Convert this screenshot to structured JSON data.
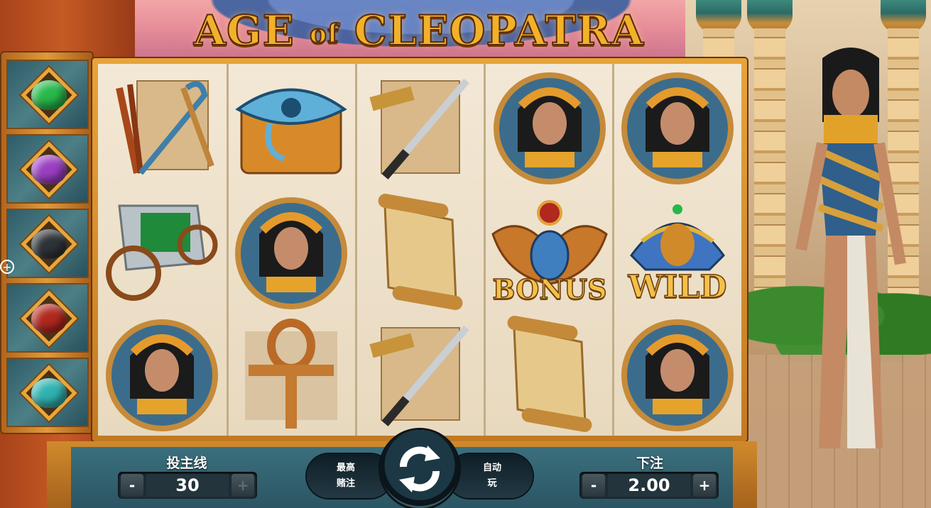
{
  "title": {
    "main_left": "AGE",
    "connector": "of",
    "main_right": "CLEOPATRA"
  },
  "scarabs": [
    {
      "color": "green",
      "hex": "#27b84a"
    },
    {
      "color": "purple",
      "hex": "#9a3fc2"
    },
    {
      "color": "black",
      "hex": "#2e3338"
    },
    {
      "color": "red",
      "hex": "#b0281e"
    },
    {
      "color": "teal",
      "hex": "#2fb2b0"
    }
  ],
  "reels": [
    [
      "crook-and-flail",
      "chariot",
      "cleopatra"
    ],
    [
      "eye-of-horus",
      "cleopatra",
      "ankh"
    ],
    [
      "sword-and-dagger",
      "scroll",
      "sword-and-dagger"
    ],
    [
      "cleopatra",
      "bonus-scarab",
      "scroll"
    ],
    [
      "cleopatra",
      "pharaoh-wild",
      "cleopatra"
    ]
  ],
  "symbol_text": {
    "bonus": "BONUS",
    "wild": "WILD"
  },
  "controls": {
    "lines_label": "投主线",
    "lines_value": "30",
    "minus": "-",
    "plus": "+",
    "max_bet_line1": "最高",
    "max_bet_line2": "赌注",
    "auto_line1": "自动",
    "auto_line2": "玩",
    "bet_label": "下注",
    "bet_value": "2.00"
  },
  "side_icon": "+"
}
